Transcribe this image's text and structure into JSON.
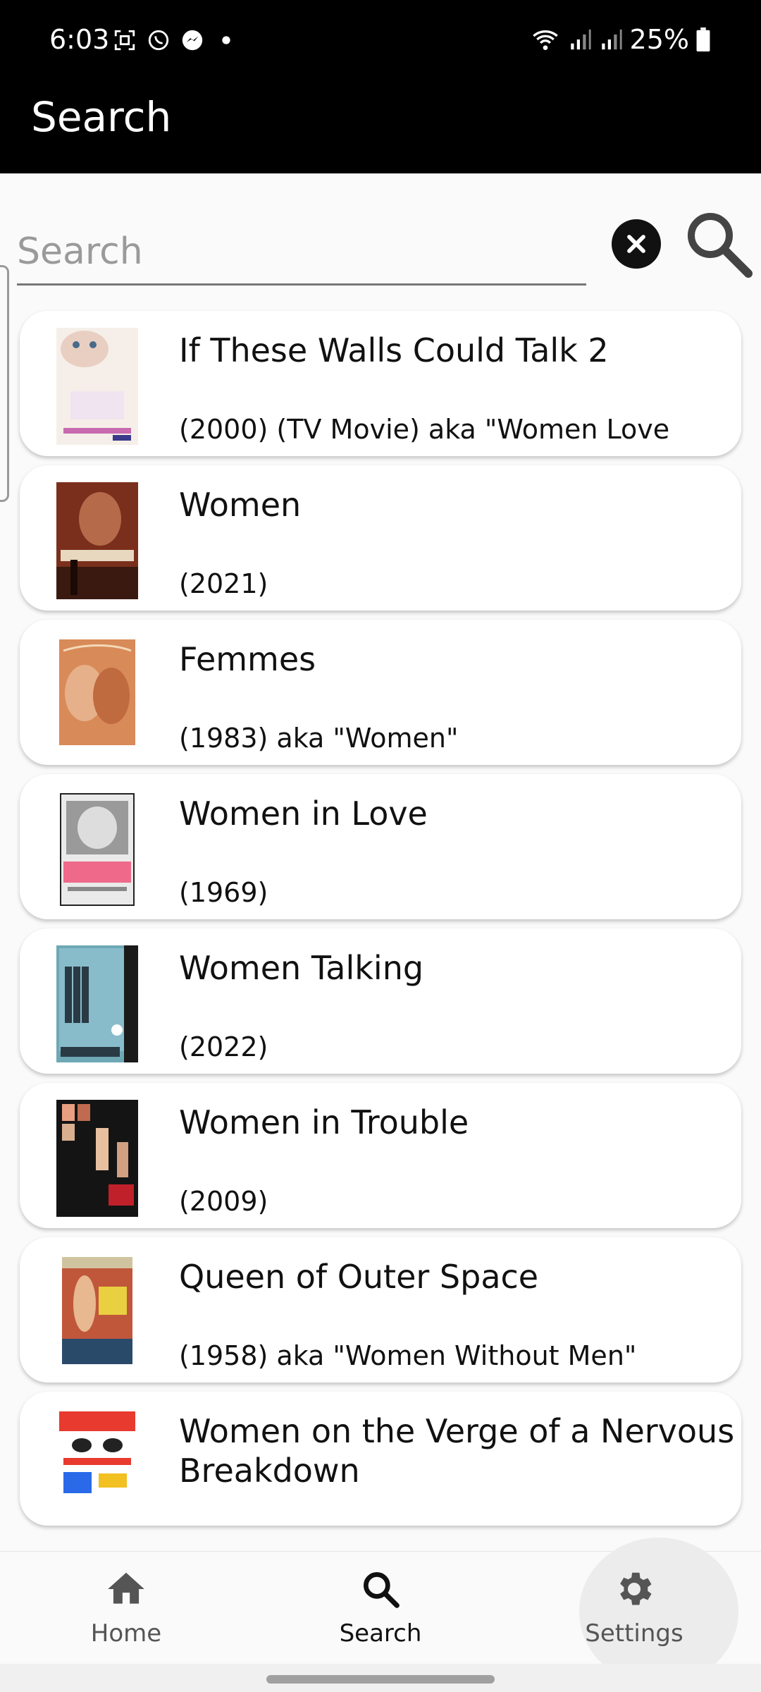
{
  "status_bar": {
    "time": "6:03",
    "battery": "25%"
  },
  "app_bar": {
    "title": "Search"
  },
  "search": {
    "placeholder": "Search",
    "value": ""
  },
  "results": [
    {
      "title": "If These Walls Could Talk 2",
      "subtitle": "(2000) (TV Movie) aka \"Women Love",
      "poster_color": "#f4ece6"
    },
    {
      "title": "Women",
      "subtitle": "(2021)",
      "poster_color": "#7a2f1c"
    },
    {
      "title": "Femmes",
      "subtitle": "(1983) aka \"Women\"",
      "poster_color": "#d88a58"
    },
    {
      "title": "Women in Love",
      "subtitle": "(1969)",
      "poster_color": "#e6e6e6"
    },
    {
      "title": "Women Talking",
      "subtitle": "(2022)",
      "poster_color": "#6ea8b5"
    },
    {
      "title": "Women in Trouble",
      "subtitle": "(2009)",
      "poster_color": "#1a1a1a"
    },
    {
      "title": "Queen of Outer Space",
      "subtitle": "(1958) aka \"Women Without Men\"",
      "poster_color": "#c0573a"
    },
    {
      "title": "Women on the Verge of a Nervous Breakdown",
      "subtitle": "",
      "poster_color": "#e83a2e"
    }
  ],
  "nav": [
    {
      "label": "Home",
      "icon": "home-icon"
    },
    {
      "label": "Search",
      "icon": "search-icon"
    },
    {
      "label": "Settings",
      "icon": "gear-icon"
    }
  ]
}
